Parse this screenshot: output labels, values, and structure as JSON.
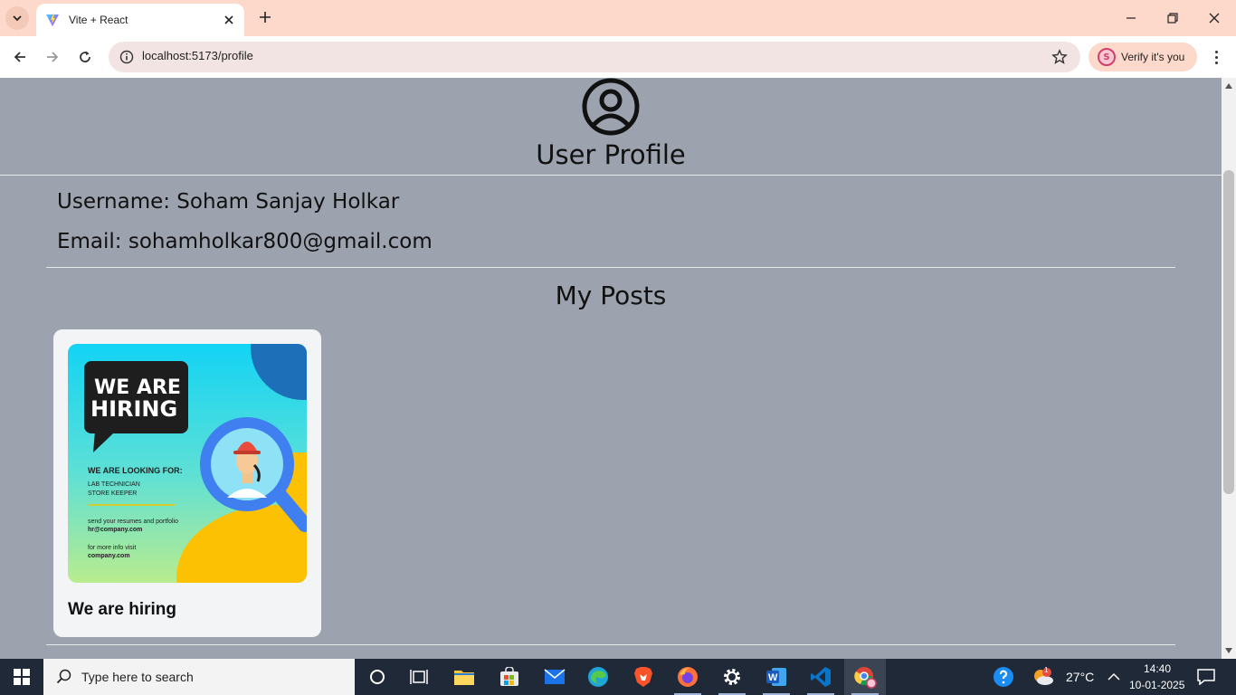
{
  "browser": {
    "tab_title": "Vite + React",
    "url": "localhost:5173/profile",
    "verify_label": "Verify it's you",
    "avatar_letter": "S"
  },
  "page": {
    "title": "User Profile",
    "username_line": "Username: Soham Sanjay Holkar",
    "email_line": "Email: sohamholkar800@gmail.com",
    "posts_heading": "My Posts",
    "posts": [
      {
        "title": "We are hiring",
        "image": {
          "headline_line1": "WE ARE",
          "headline_line2": "HIRING",
          "looking_for": "WE ARE LOOKING FOR:",
          "role1": "LAB TECHNICIAN",
          "role2": "STORE KEEPER",
          "send_text": "send your resumes and portfolio",
          "email": "hr@company.com",
          "more_info": "for more info visit",
          "site": "company.com"
        }
      }
    ]
  },
  "taskbar": {
    "search_placeholder": "Type here to search",
    "weather": "27°C",
    "weather_badge": "1",
    "time": "14:40",
    "date": "10-01-2025"
  },
  "colors": {
    "page_bg": "#9ca3af",
    "tabbar_bg": "#fcd9cb",
    "card_bg": "#f3f4f6",
    "taskbar_bg": "#1f2937"
  }
}
